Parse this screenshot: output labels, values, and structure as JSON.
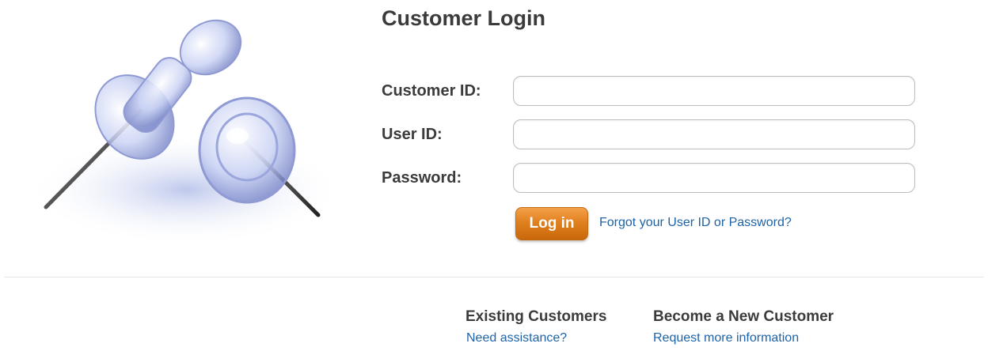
{
  "title": "Customer Login",
  "form": {
    "customer_id_label": "Customer ID:",
    "customer_id_value": "",
    "user_id_label": "User ID:",
    "user_id_value": "",
    "password_label": "Password:",
    "password_value": "",
    "login_button": "Log in",
    "forgot_link": "Forgot your User ID or Password?"
  },
  "footer": {
    "existing": {
      "heading": "Existing Customers",
      "link": "Need assistance?"
    },
    "new": {
      "heading": "Become a New Customer",
      "link": "Request more information"
    }
  },
  "hero": {
    "icon": "push-pins-image"
  },
  "colors": {
    "accent_orange": "#e0811f",
    "link_blue": "#1e63a8",
    "heading_gray": "#3b3b3b"
  }
}
